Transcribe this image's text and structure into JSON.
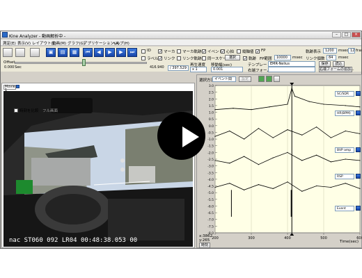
{
  "window": {
    "title": "Kine Analyzer - 動画解析中 -"
  },
  "menu": [
    {
      "label": "測定(E)"
    },
    {
      "label": "表示(V)"
    },
    {
      "label": "レイアウト(L)"
    },
    {
      "label": "動画(M)"
    },
    {
      "label": "グラフ(G)"
    },
    {
      "label": "アプリケーション(A)"
    },
    {
      "label": "ヘルプ(H)"
    }
  ],
  "toolbar": {
    "checks": [
      {
        "label": "ID",
        "checked": false
      },
      {
        "label": "マーカ",
        "checked": true
      },
      {
        "label": "マーカ軌跡",
        "checked": false
      },
      {
        "label": "イベント",
        "checked": true
      },
      {
        "label": "心拍",
        "checked": true
      },
      {
        "label": "縦軸値",
        "checked": false
      },
      {
        "label": "FP",
        "checked": true
      },
      {
        "label": "ラベル",
        "checked": false
      },
      {
        "label": "リンク",
        "checked": true
      },
      {
        "label": "リンク軌跡",
        "checked": false
      },
      {
        "label": "同一スケール",
        "checked": false
      },
      {
        "label": "軌跡",
        "checked": true
      }
    ],
    "select_button": "選択",
    "fp_range_label": "FP範囲",
    "fp_range_value": "10000",
    "fp_range_unit": "msec",
    "trace_display_label": "軌跡表示",
    "trace_display_value": "1200",
    "trace_display_unit": "msec",
    "frame_value": "12",
    "frame_unit": "fram",
    "link_count_label": "リンク個数",
    "link_count_value": "84",
    "link_count_unit": "msec",
    "offset_label": "Offset",
    "offset_value": "0.000",
    "offset_unit": "Sec",
    "time_readout": "416.940",
    "time_total": "/ 397.529 Sec",
    "speed_label": "再生速度",
    "speed_value": "x 1",
    "move_label": "移動幅(sec)",
    "move_value": "0.001",
    "template_label": "テンプレート",
    "template_value": "EMR-Nelius",
    "waveform_label": "右端フォーム",
    "save_button": "保存",
    "load_button": "読込",
    "right_form_button": "右端フォームの追加..."
  },
  "video": {
    "tab_label": "Movie 1",
    "checkbox_label": "時刻を比較",
    "dim_label": "フル画面",
    "timestamp": "nac ST060 092 LR04 00:48:38.053  00"
  },
  "plot": {
    "toolbar_label": "選択方法",
    "toolbar_select": "イベント間",
    "series_labels": [
      "SC/SDR",
      "HR(BPM)",
      "BVP amp",
      "RSP",
      "Event"
    ],
    "xlabel": "Time(sec)",
    "status": "時刻",
    "corner_x": "x:3862",
    "corner_y": "y:265"
  },
  "chart_data": {
    "type": "line",
    "xlabel": "Time(sec)",
    "xlim": [
      200,
      600
    ],
    "x_ticks": [
      200,
      300,
      400,
      500,
      600
    ],
    "y_ticks": [
      "3.0",
      "2.5",
      "2.0",
      "1.5",
      "1.0",
      "0.5",
      "0.0",
      "-0.5",
      "-1.0",
      "-1.5",
      "-2.0",
      "-2.5",
      "-3.0",
      "-3.5",
      "-4.0",
      "-4.5",
      "-5.0",
      "-5.5",
      "-6.0",
      "-6.5",
      "-7.0",
      "-7.5",
      "-8.0"
    ],
    "ylim": [
      -8.0,
      3.0
    ],
    "cursor_x": 412,
    "series": [
      {
        "name": "SC/SDR",
        "color": "#000000",
        "x": [
          200,
          250,
          300,
          350,
          400,
          412,
          420,
          460,
          500,
          560,
          600
        ],
        "values": [
          1.2,
          1.3,
          1.2,
          1.4,
          1.6,
          2.8,
          2.2,
          1.8,
          1.6,
          1.5,
          1.4
        ]
      },
      {
        "name": "HR(BPM)",
        "color": "#000000",
        "x": [
          200,
          240,
          280,
          320,
          360,
          400,
          440,
          480,
          520,
          560,
          600
        ],
        "values": [
          -0.8,
          -0.4,
          -1.0,
          -0.2,
          -0.9,
          -0.3,
          -0.7,
          -0.1,
          -0.9,
          -0.4,
          -0.6
        ]
      },
      {
        "name": "BVP amp",
        "color": "#000000",
        "x": [
          200,
          240,
          280,
          320,
          360,
          400,
          440,
          480,
          520,
          560,
          600
        ],
        "values": [
          -2.6,
          -2.8,
          -2.3,
          -2.9,
          -2.4,
          -2.0,
          -2.6,
          -2.2,
          -2.7,
          -2.5,
          -2.6
        ]
      },
      {
        "name": "RSP",
        "color": "#000000",
        "x": [
          200,
          240,
          280,
          320,
          360,
          400,
          440,
          480,
          520,
          560,
          600
        ],
        "values": [
          -4.6,
          -4.3,
          -4.8,
          -4.4,
          -4.7,
          -4.2,
          -4.9,
          -4.5,
          -4.6,
          -4.3,
          -4.7
        ]
      },
      {
        "name": "Event",
        "color": "#000000",
        "x": [
          245,
          410,
          412
        ],
        "values": [
          -6.0,
          -6.0,
          -6.0
        ]
      }
    ]
  },
  "colors": {
    "red": "#e0262d",
    "titlebar": "#2a6ac8",
    "plot_bg": "#ffffe6"
  }
}
